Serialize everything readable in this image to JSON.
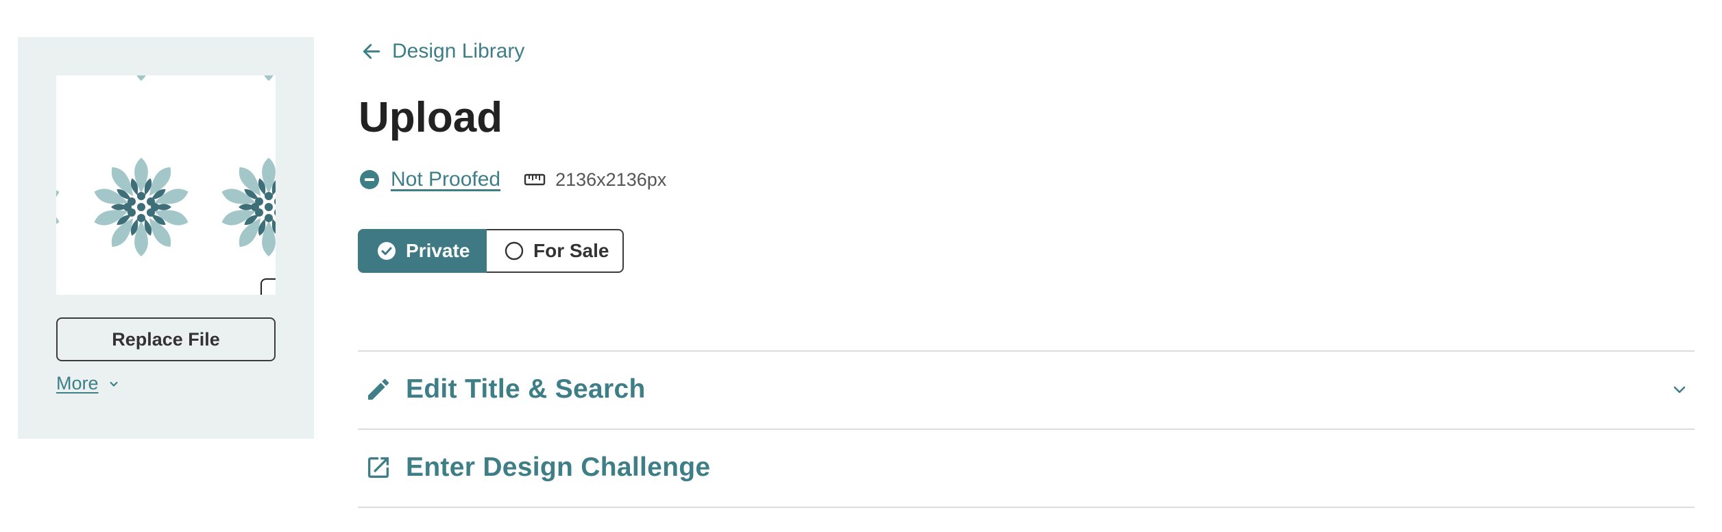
{
  "sidebar": {
    "replace_label": "Replace File",
    "more_label": "More"
  },
  "nav": {
    "back_label": "Design Library"
  },
  "page": {
    "title": "Upload"
  },
  "status": {
    "proof_label": "Not Proofed",
    "dimensions": "2136x2136px"
  },
  "visibility": {
    "options": [
      "Private",
      "For Sale"
    ],
    "selected": "Private"
  },
  "sections": [
    {
      "label": "Edit Title & Search",
      "icon": "pencil-icon",
      "expandable": true
    },
    {
      "label": "Enter Design Challenge",
      "icon": "external-link-icon",
      "expandable": false
    }
  ],
  "colors": {
    "accent": "#3e7e87",
    "toggle_selected": "#3f7a84",
    "sidebar_bg": "#ebf1f1",
    "pattern_light": "#a3c6c9",
    "pattern_dark": "#3e6e78"
  }
}
